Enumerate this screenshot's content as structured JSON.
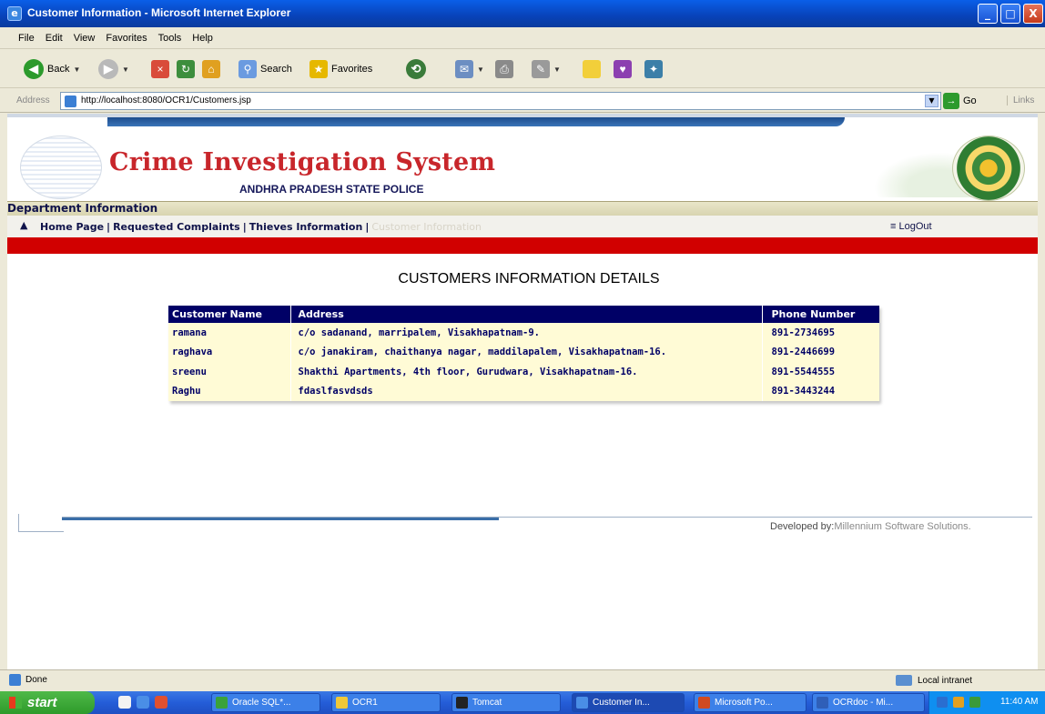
{
  "window": {
    "title": "Customer Information - Microsoft Internet Explorer",
    "minimize": "_",
    "maximize": "□",
    "close": "X"
  },
  "menu": [
    "File",
    "Edit",
    "View",
    "Favorites",
    "Tools",
    "Help"
  ],
  "toolbar": {
    "back": "Back",
    "search": "Search",
    "favorites": "Favorites"
  },
  "address": {
    "label": "Address",
    "url": "http://localhost:8080/OCR1/Customers.jsp",
    "go": "Go",
    "links": "Links"
  },
  "site": {
    "title": "Crime Investigation System",
    "subtitle": "ANDHRA PRADESH STATE POLICE",
    "section": "Department Information",
    "nav": [
      "Home Page",
      "Requested Complaints",
      "Thieves Information",
      "Customer Information"
    ],
    "nav_sep": "|",
    "logout": "LogOut",
    "heading": "CUSTOMERS INFORMATION DETAILS",
    "developed_by_label": "Developed by:",
    "developed_by_name": "Millennium Software Solutions."
  },
  "table": {
    "headers": [
      "Customer Name",
      "Address",
      "Phone Number"
    ],
    "rows": [
      [
        "ramana",
        "c/o sadanand, marripalem, Visakhapatnam-9.",
        "891-2734695"
      ],
      [
        "raghava",
        "c/o janakiram, chaithanya nagar, maddilapalem, Visakhapatnam-16.",
        "891-2446699"
      ],
      [
        "sreenu",
        "Shakthi Apartments, 4th floor, Gurudwara, Visakhapatnam-16.",
        "891-5544555"
      ],
      [
        "Raghu",
        "fdaslfasvdsds",
        "891-3443244"
      ]
    ]
  },
  "status": {
    "text": "Done",
    "zone": "Local intranet"
  },
  "taskbar": {
    "start": "start",
    "tasks": [
      "Oracle SQL*...",
      "OCR1",
      "Tomcat",
      "Customer In...",
      "Microsoft Po...",
      "OCRdoc - Mi..."
    ],
    "clock": "11:40 AM"
  },
  "colors": {
    "title_red": "#c8262b",
    "nav_navy": "#10134a",
    "table_header": "#000066",
    "table_body": "#fffbd6",
    "red_bar": "#d10000"
  }
}
